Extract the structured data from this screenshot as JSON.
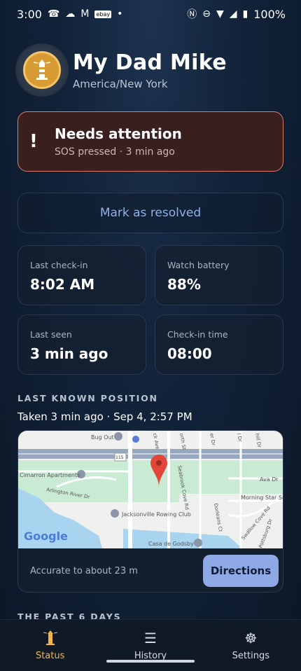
{
  "status_bar": {
    "time": "3:00",
    "battery": "100%"
  },
  "header": {
    "title": "My Dad Mike",
    "timezone": "America/New York"
  },
  "alert": {
    "title": "Needs attention",
    "subtitle": "SOS pressed · 3 min ago"
  },
  "resolve_button": "Mark as resolved",
  "cards": [
    {
      "label": "Last check-in",
      "value": "8:02 AM"
    },
    {
      "label": "Watch battery",
      "value": "88%"
    },
    {
      "label": "Last seen",
      "value": "3 min ago"
    },
    {
      "label": "Check-in time",
      "value": "08:00"
    }
  ],
  "position": {
    "heading": "LAST KNOWN POSITION",
    "taken": "Taken 3 min ago · Sep 4, 2:57 PM",
    "accuracy": "Accurate to about 23 m",
    "directions_button": "Directions",
    "map_labels": {
      "bug_out": "Bug Out",
      "road": "115",
      "cimarron": "Cimarron Apartments",
      "arlington": "Arlington River Dr",
      "rowing": "Jacksonville Rowing Club",
      "godsby": "Casa de Godsby",
      "ava": "Ava Dr",
      "morning": "Morning Star Sch",
      "google": "Google",
      "seabrook": "Seabrook Cove Rd",
      "dorleans": "Dorleans Ct",
      "swallow": "Swallow Cove Rd",
      "pottsburg": "Pottsburg Dr",
      "north": "orth St",
      "creek": "ck Ave",
      "river_dr": "er Dr",
      "hill": "hill Dr",
      "l_dr": "l Dr"
    }
  },
  "past_days": "THE PAST 6 DAYS",
  "nav": [
    {
      "label": "Status",
      "icon": "lighthouse-icon"
    },
    {
      "label": "History",
      "icon": "list-icon"
    },
    {
      "label": "Settings",
      "icon": "helm-icon"
    }
  ],
  "colors": {
    "accent": "#f0b64b",
    "alert_border": "#e07a68",
    "link": "#8fb0e8",
    "button": "#8fa9e6"
  }
}
